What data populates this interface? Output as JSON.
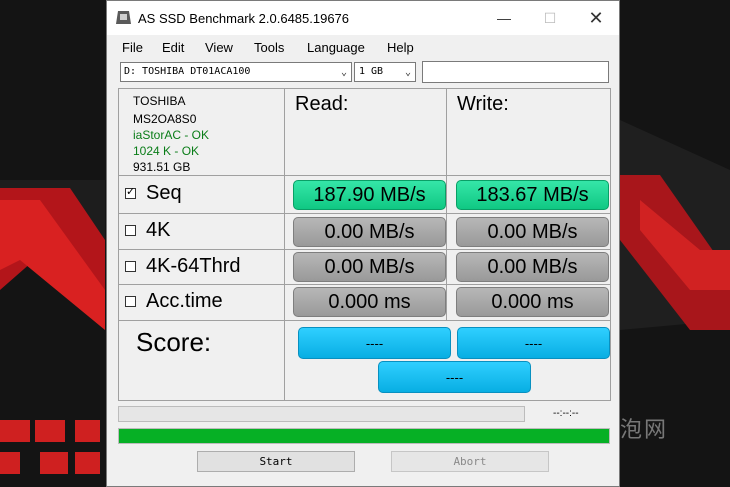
{
  "window": {
    "title": "AS SSD Benchmark 2.0.6485.19676",
    "controls": {
      "minimize": "—",
      "maximize": "☐",
      "close": "✕"
    }
  },
  "menu": [
    "File",
    "Edit",
    "View",
    "Tools",
    "Language",
    "Help"
  ],
  "toolbar": {
    "drive": "D: TOSHIBA DT01ACA100",
    "size": "1 GB"
  },
  "drive_info": {
    "model": "TOSHIBA",
    "firmware": "MS2OA8S0",
    "driver": "iaStorAC - OK",
    "alignment": "1024 K - OK",
    "capacity": "931.51 GB"
  },
  "headers": {
    "read": "Read:",
    "write": "Write:"
  },
  "tests": [
    {
      "label": "Seq",
      "checked": true,
      "read": "187.90 MB/s",
      "write": "183.67 MB/s"
    },
    {
      "label": "4K",
      "checked": false,
      "read": "0.00 MB/s",
      "write": "0.00 MB/s"
    },
    {
      "label": "4K-64Thrd",
      "checked": false,
      "read": "0.00 MB/s",
      "write": "0.00 MB/s"
    },
    {
      "label": "Acc.time",
      "checked": false,
      "read": "0.000 ms",
      "write": "0.000 ms"
    }
  ],
  "score": {
    "label": "Score:",
    "read": "----",
    "write": "----",
    "total": "----"
  },
  "status": {
    "timer": "--:--:--",
    "progress": 1.0
  },
  "buttons": {
    "start": "Start",
    "abort": "Abort"
  },
  "watermark": "泡泡网",
  "colors": {
    "accent_green": "#10c883",
    "score_blue": "#08aee3",
    "progress_green": "#06b025",
    "ok_text": "#0a7d18",
    "wallpaper_red": "#d21a1a"
  }
}
